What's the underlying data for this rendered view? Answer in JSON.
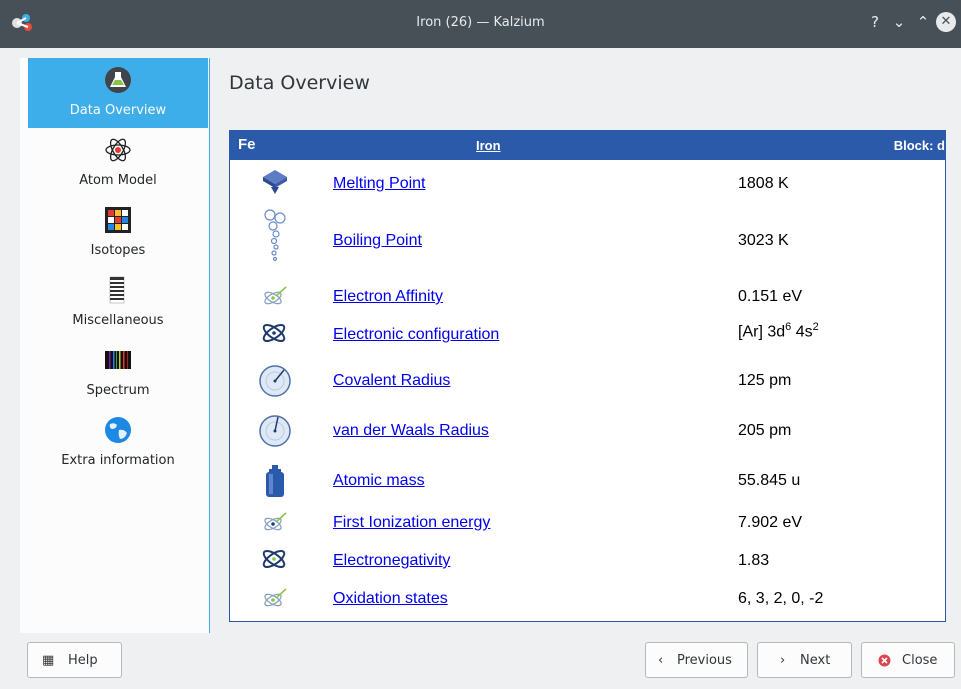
{
  "window": {
    "title": "Iron (26) — Kalzium",
    "help_glyph": "?",
    "minimize_glyph": "⌄",
    "maximize_glyph": "⌃",
    "close_glyph": "✕"
  },
  "sidebar": {
    "items": [
      {
        "label": "Data Overview",
        "icon": "flask-icon",
        "active": true
      },
      {
        "label": "Atom Model",
        "icon": "atom-icon",
        "active": false
      },
      {
        "label": "Isotopes",
        "icon": "isotopes-icon",
        "active": false
      },
      {
        "label": "Miscellaneous",
        "icon": "document-lines-icon",
        "active": false
      },
      {
        "label": "Spectrum",
        "icon": "spectrum-icon",
        "active": false
      },
      {
        "label": "Extra information",
        "icon": "globe-icon",
        "active": false
      }
    ]
  },
  "main": {
    "title": "Data Overview",
    "element": {
      "symbol": "Fe",
      "name": "Iron",
      "block": "Block: d"
    },
    "properties": [
      {
        "label": "Melting Point",
        "value": "1808 K",
        "icon": "melting-point-icon"
      },
      {
        "label": "Boiling Point",
        "value": "3023 K",
        "icon": "boiling-point-icon"
      },
      {
        "label": "Electron Affinity",
        "value": "0.151 eV",
        "icon": "electron-affinity-icon"
      },
      {
        "label": "Electronic configuration",
        "value_parts": [
          "[Ar] 3d",
          "6",
          " 4s",
          "2"
        ],
        "icon": "electron-config-icon"
      },
      {
        "label": "Covalent Radius",
        "value": "125 pm",
        "icon": "covalent-radius-icon"
      },
      {
        "label": "van der Waals Radius",
        "value": "205 pm",
        "icon": "vdw-radius-icon"
      },
      {
        "label": "Atomic mass",
        "value": "55.845 u",
        "icon": "atomic-mass-icon"
      },
      {
        "label": "First Ionization energy",
        "value": "7.902 eV",
        "icon": "ionization-icon"
      },
      {
        "label": "Electronegativity",
        "value": "1.83",
        "icon": "electronegativity-icon"
      },
      {
        "label": "Oxidation states",
        "value": "6, 3, 2, 0, -2",
        "icon": "oxidation-icon"
      }
    ]
  },
  "footer": {
    "help_label": "Help",
    "previous_label": "Previous",
    "next_label": "Next",
    "close_label": "Close"
  },
  "colors": {
    "accent": "#3daee9",
    "header": "#2b5aaa",
    "link": "#0000ee",
    "titlebar": "#475057"
  }
}
